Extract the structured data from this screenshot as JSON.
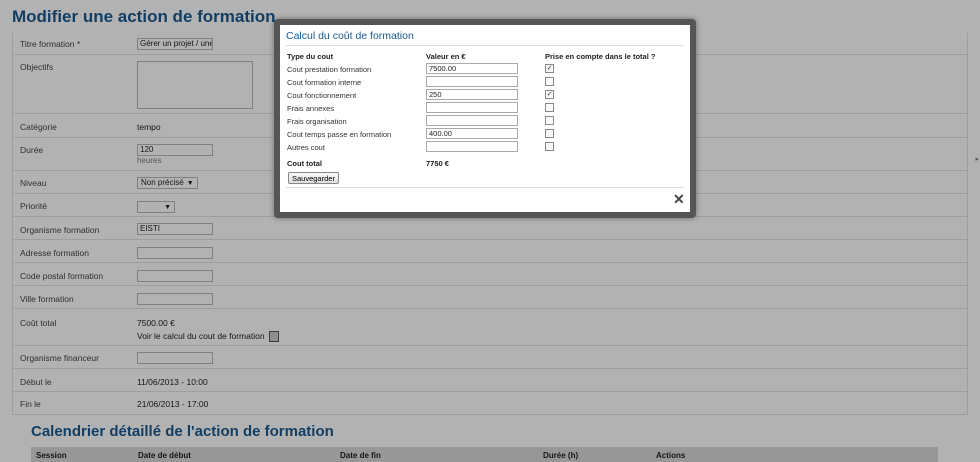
{
  "page": {
    "title": "Modifier une action de formation",
    "fields": {
      "titre": {
        "label": "Titre formation *",
        "value": "Gérer un projet / une é"
      },
      "objectifs": {
        "label": "Objectifs"
      },
      "categorie": {
        "label": "Catégorie",
        "value": "tempo"
      },
      "duree": {
        "label": "Durée",
        "value": "120",
        "unit": "heures"
      },
      "niveau": {
        "label": "Niveau",
        "value": "Non précisé"
      },
      "priorite": {
        "label": "Priorité",
        "value": ""
      },
      "organisme": {
        "label": "Organisme formation",
        "value": "EISTI"
      },
      "adresse": {
        "label": "Adresse formation",
        "value": ""
      },
      "code_postal": {
        "label": "Code postal formation",
        "value": ""
      },
      "ville": {
        "label": "Ville formation",
        "value": ""
      },
      "cout_total": {
        "label": "Coût total",
        "value": "7500.00 €",
        "link": "Voir le calcul du cout de formation"
      },
      "financeur": {
        "label": "Organisme financeur",
        "value": ""
      },
      "debut": {
        "label": "Début le",
        "value": "11/06/2013 - 10:00"
      },
      "fin": {
        "label": "Fin le",
        "value": "21/06/2013 - 17:00"
      }
    },
    "calendar": {
      "title": "Calendrier détaillé de l'action de formation",
      "columns": [
        "Session",
        "Date de début",
        "Date de fin",
        "Durée (h)",
        "Actions"
      ]
    }
  },
  "modal": {
    "title": "Calcul du coût de formation",
    "headers": {
      "type": "Type du cout",
      "value": "Valeur en €",
      "include": "Prise en compte dans le total ?"
    },
    "rows": [
      {
        "label": "Cout prestation formation",
        "value": "7500.00",
        "checked": "✓"
      },
      {
        "label": "Cout formation interne",
        "value": "",
        "checked": ""
      },
      {
        "label": "Cout fonctionnement",
        "value": "250",
        "checked": "✓"
      },
      {
        "label": "Frais annexes",
        "value": "",
        "checked": ""
      },
      {
        "label": "Frais organisation",
        "value": "",
        "checked": ""
      },
      {
        "label": "Cout temps passe en formation",
        "value": "400.00",
        "checked": ""
      },
      {
        "label": "Autres cout",
        "value": "",
        "checked": ""
      }
    ],
    "total_label": "Cout total",
    "total_value": "7750 €",
    "save_label": "Sauvegarder",
    "close_icon": "close-icon"
  }
}
